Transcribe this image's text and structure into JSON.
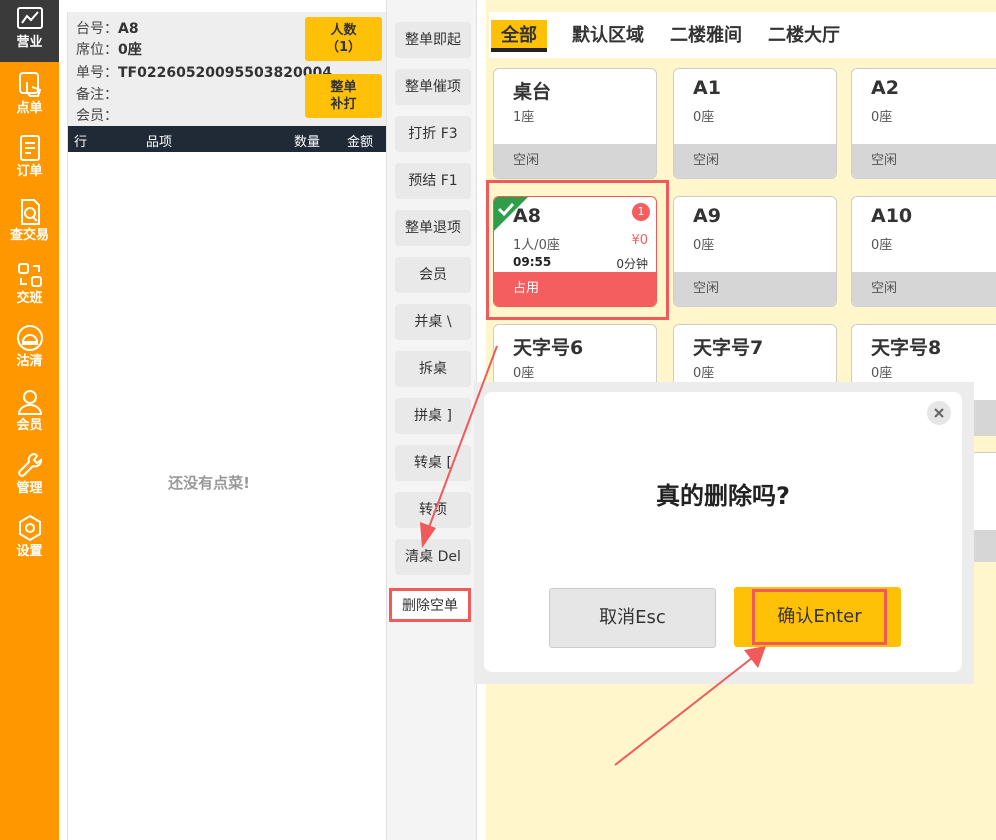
{
  "nav": [
    {
      "label": "营业",
      "icon": "chart-icon"
    },
    {
      "label": "点单",
      "icon": "hand-tap-icon"
    },
    {
      "label": "订单",
      "icon": "document-icon"
    },
    {
      "label": "查交易",
      "icon": "search-doc-icon"
    },
    {
      "label": "交班",
      "icon": "swap-icon"
    },
    {
      "label": "沽清",
      "icon": "dish-cover-icon"
    },
    {
      "label": "会员",
      "icon": "user-icon"
    },
    {
      "label": "管理",
      "icon": "wrench-icon"
    },
    {
      "label": "设置",
      "icon": "gear-icon"
    }
  ],
  "order": {
    "table_label": "台号：",
    "table": "A8",
    "seat_label": "席位：",
    "seat": "0座",
    "no_label": "单号：",
    "no": "TF02260520095503820004",
    "note_label": "备注：",
    "member_label": "会员：",
    "people_btn_line1": "人数",
    "people_btn_line2": "（1）",
    "reprint_btn_line1": "整单",
    "reprint_btn_line2": "补打",
    "cols": {
      "row": "行",
      "item": "品项",
      "qty": "数量",
      "amount": "金额"
    },
    "empty_text": "还没有点菜!"
  },
  "actions": [
    "整单即起",
    "整单催项",
    "打折 F3",
    "预结 F1",
    "整单退项",
    "会员",
    "并桌 \\",
    "拆桌",
    "拼桌 ]",
    "转桌 [",
    "转项",
    "清桌 Del",
    "删除空单"
  ],
  "tabs": [
    "全部",
    "默认区域",
    "二楼雅间",
    "二楼大厅"
  ],
  "cards": [
    {
      "name": "桌台",
      "sub": "1座",
      "status": "空闲"
    },
    {
      "name": "A1",
      "sub": "0座",
      "status": "空闲"
    },
    {
      "name": "A2",
      "sub": "0座",
      "status": "空闲"
    },
    {
      "name": "A8",
      "sub": "1人/0座",
      "status": "占用",
      "price": "¥0",
      "time": "09:55",
      "duration": "0分钟",
      "badge": "1"
    },
    {
      "name": "A9",
      "sub": "0座",
      "status": "空闲"
    },
    {
      "name": "A10",
      "sub": "0座",
      "status": "空闲"
    },
    {
      "name": "天字号6",
      "sub": "0座"
    },
    {
      "name": "天字号7",
      "sub": "0座"
    },
    {
      "name": "天字号8",
      "sub": "0座"
    }
  ],
  "dialog": {
    "title": "真的删除吗?",
    "cancel": "取消Esc",
    "confirm": "确认Enter"
  },
  "colors": {
    "accent": "#FF9800",
    "yellow": "#FFC107",
    "highlight": "#f05a5a",
    "occupied": "#f45e5e"
  }
}
